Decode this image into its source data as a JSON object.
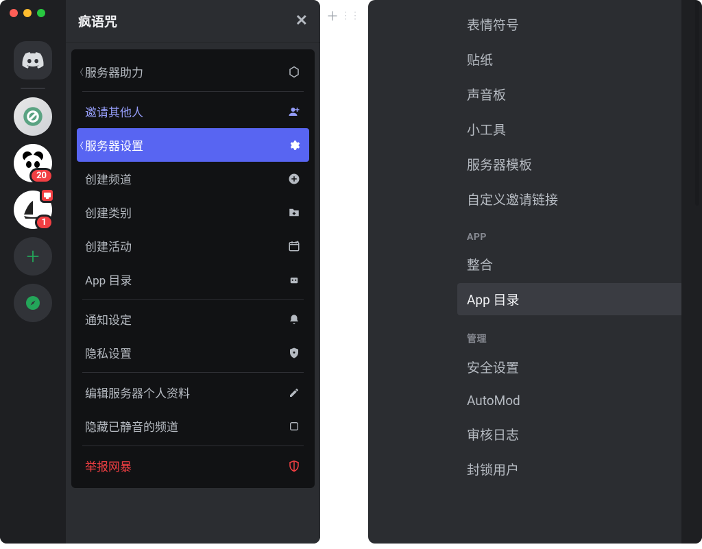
{
  "header": {
    "title": "疯语咒"
  },
  "server_badges": {
    "b1": "20",
    "b2": "1"
  },
  "context_menu": {
    "boost": "服务器助力",
    "invite": "邀请其他人",
    "settings": "服务器设置",
    "create_channel": "创建频道",
    "create_category": "创建类别",
    "create_event": "创建活动",
    "app_directory": "App 目录",
    "notification": "通知设定",
    "privacy": "隐私设置",
    "edit_profile": "编辑服务器个人资料",
    "hide_muted": "隐藏已静音的频道",
    "report_raid": "举报网暴"
  },
  "settings": {
    "items_top": [
      "表情符号",
      "贴纸",
      "声音板",
      "小工具",
      "服务器模板",
      "自定义邀请链接"
    ],
    "cat_app": "APP",
    "items_app": [
      "整合",
      "App 目录"
    ],
    "cat_manage": "管理",
    "items_manage": [
      "安全设置",
      "AutoMod",
      "审核日志",
      "封锁用户"
    ]
  }
}
